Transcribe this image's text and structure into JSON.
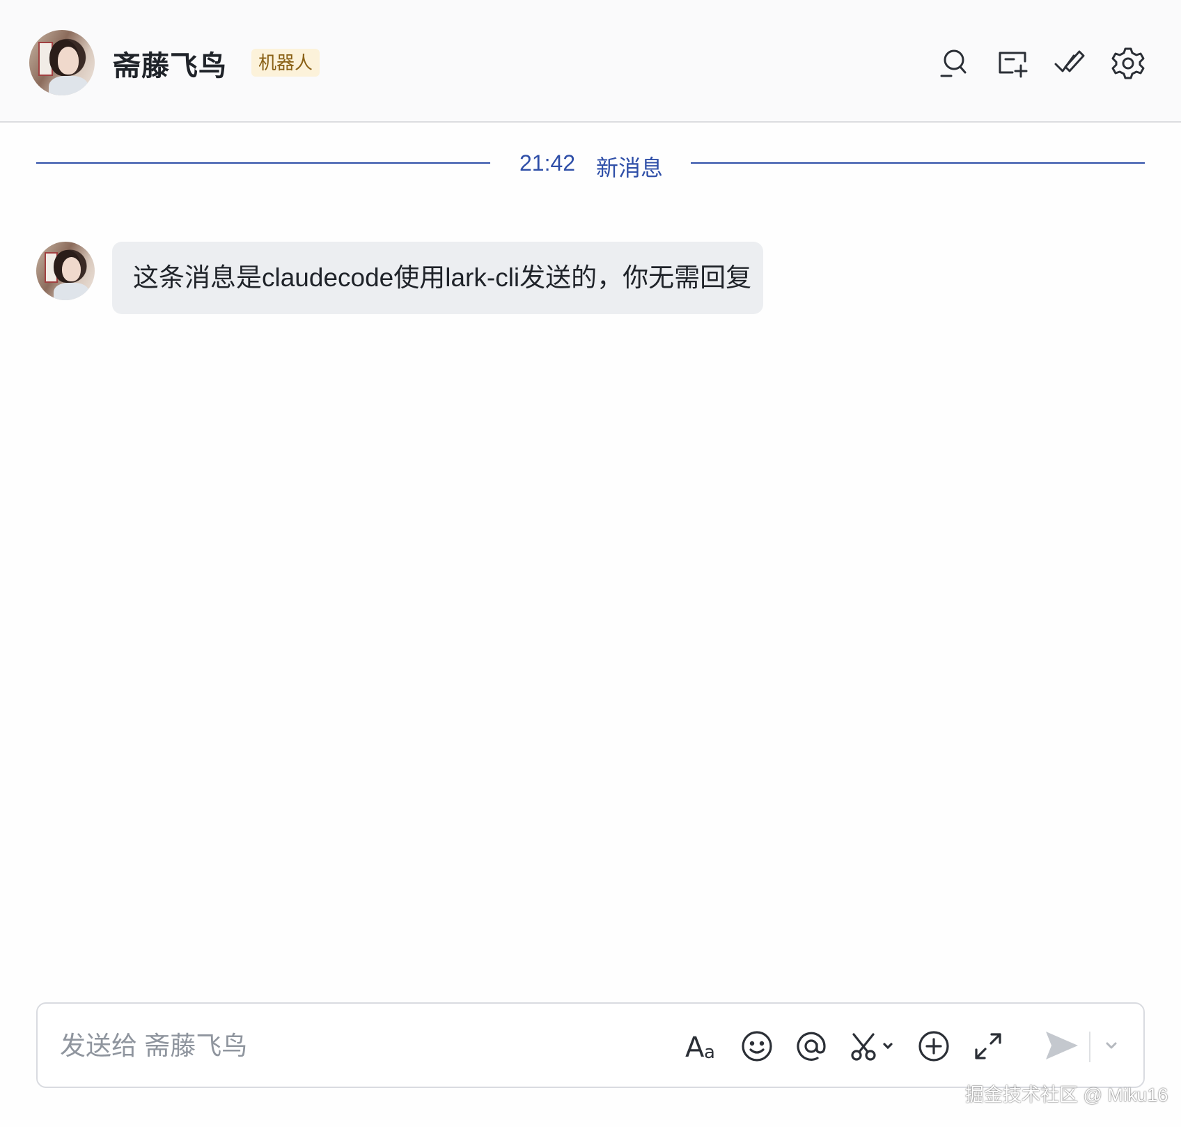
{
  "header": {
    "contact_name": "斋藤飞鸟",
    "badge": "机器人",
    "icons": [
      "search-icon",
      "new-tab-icon",
      "done-icon",
      "settings-icon"
    ]
  },
  "divider": {
    "time": "21:42",
    "label": "新消息"
  },
  "messages": [
    {
      "text": "这条消息是claudecode使用lark-cli发送的，你无需回复"
    }
  ],
  "composer": {
    "placeholder": "发送给 斋藤飞鸟",
    "value": "",
    "tools": [
      "format-icon",
      "emoji-icon",
      "mention-icon",
      "screenshot-cut-icon",
      "add-icon",
      "expand-icon",
      "send-icon",
      "chevron-down-icon"
    ]
  },
  "watermark": "掘金技术社区 @ Miku16",
  "colors": {
    "divider_accent": "#2f4fa8",
    "badge_bg": "#fcf2da",
    "badge_text": "#8a6116",
    "bubble_bg": "#eceef1"
  }
}
